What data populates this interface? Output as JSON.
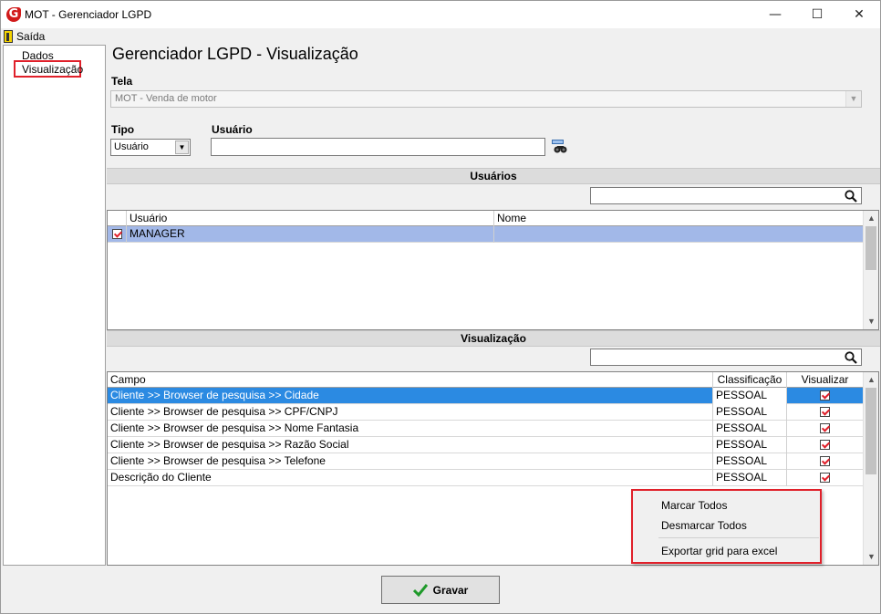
{
  "window": {
    "title": "MOT - Gerenciador LGPD",
    "logo_letter": "G",
    "minimize": "—",
    "maximize": "☐",
    "close": "✕"
  },
  "menu": {
    "saida": "Saída"
  },
  "sidebar": {
    "items": [
      {
        "label": "Dados"
      },
      {
        "label": "Visualização",
        "selected": true
      }
    ]
  },
  "main": {
    "title": "Gerenciador LGPD - Visualização",
    "tela_label": "Tela",
    "tela_value": "MOT - Venda de motor",
    "tipo_label": "Tipo",
    "tipo_value": "Usuário",
    "usuario_label": "Usuário",
    "usuario_value": ""
  },
  "usuarios_section": {
    "header": "Usuários",
    "search_value": "",
    "columns": [
      "Usuário",
      "Nome"
    ],
    "rows": [
      {
        "checked": true,
        "usuario": "MANAGER",
        "nome": ""
      }
    ]
  },
  "visualizacao_section": {
    "header": "Visualização",
    "search_value": "",
    "columns": [
      "Campo",
      "Classificação",
      "Visualizar"
    ],
    "rows": [
      {
        "campo": "Cliente >> Browser de pesquisa >> Cidade",
        "classificacao": "PESSOAL",
        "visualizar": true,
        "selected": true
      },
      {
        "campo": "Cliente >> Browser de pesquisa >> CPF/CNPJ",
        "classificacao": "PESSOAL",
        "visualizar": true
      },
      {
        "campo": "Cliente >> Browser de pesquisa >> Nome Fantasia",
        "classificacao": "PESSOAL",
        "visualizar": true
      },
      {
        "campo": "Cliente >> Browser de pesquisa >> Razão Social",
        "classificacao": "PESSOAL",
        "visualizar": true
      },
      {
        "campo": "Cliente >> Browser de pesquisa >> Telefone",
        "classificacao": "PESSOAL",
        "visualizar": true
      },
      {
        "campo": "Descrição do Cliente",
        "classificacao": "PESSOAL",
        "visualizar": true
      }
    ]
  },
  "context_menu": {
    "items": [
      "Marcar Todos",
      "Desmarcar Todos",
      "Exportar grid para excel"
    ]
  },
  "footer": {
    "save_label": "Gravar"
  },
  "colors": {
    "accent_red": "#e0202a",
    "selection_blue": "#2b8ae2",
    "user_selection": "#a2b8e8"
  }
}
